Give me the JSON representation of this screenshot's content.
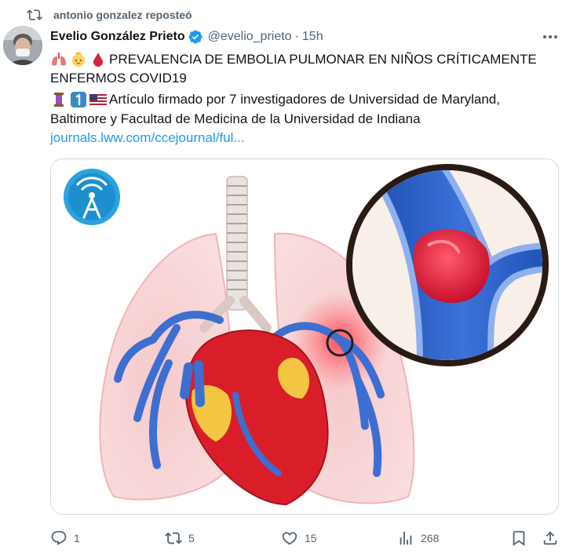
{
  "repost": {
    "icon": "repost-icon",
    "text": "antonio gonzalez reposteó"
  },
  "author": {
    "avatar": "avatar-photo",
    "name": "Evelio González Prieto",
    "verified_icon": "verified-badge-icon",
    "handle": "@evelio_prieto",
    "separator": "·",
    "time": "15h"
  },
  "more_icon": "more-options-icon",
  "tweet": {
    "line1_emojis": [
      "lungs-emoji",
      "baby-emoji",
      "blood-drop-emoji"
    ],
    "line1": "PREVALENCIA DE EMBOLIA PULMONAR EN NIÑOS CRÍTICAMENTE",
    "line2": "ENFERMOS COVID19",
    "line3_emojis": [
      "thread-emoji",
      "keycap-one-emoji",
      "us-flag-emoji"
    ],
    "line3": "Artículo firmado por 7 investigadores de Universidad de Maryland,",
    "line4": "Baltimore y Facultad de Medicina de la Universidad de Indiana",
    "link": "journals.lww.com/ccejournal/ful..."
  },
  "media": {
    "description_icon": "lungs-heart-embolism-illustration",
    "badge_icon": "broadcast-tower-icon"
  },
  "actions": {
    "reply": {
      "icon": "reply-icon",
      "count": "1"
    },
    "repost": {
      "icon": "repost-icon",
      "count": "5"
    },
    "like": {
      "icon": "heart-icon",
      "count": "15"
    },
    "views": {
      "icon": "views-icon",
      "count": "268"
    },
    "bookmark": {
      "icon": "bookmark-icon"
    },
    "share": {
      "icon": "share-icon"
    }
  },
  "colors": {
    "accent": "#1d9bf0",
    "muted": "#536471",
    "text": "#0f1419",
    "border": "#cfd9de"
  }
}
